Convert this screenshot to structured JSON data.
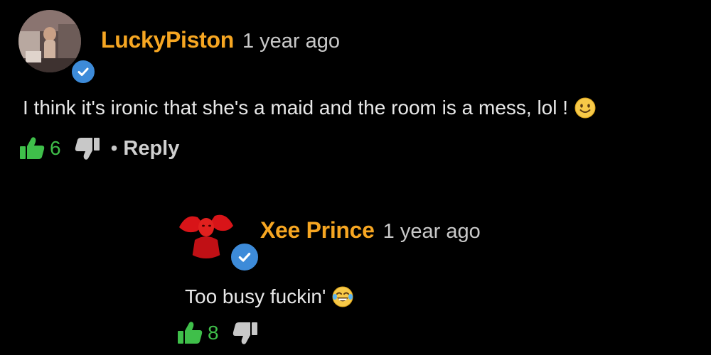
{
  "comments": [
    {
      "username": "LuckyPiston",
      "time": "1 year ago",
      "text": "I think it's ironic that she's a maid and the room is a mess, lol !",
      "emoji": "slightly-smiling-face",
      "likes": "6",
      "separator": "•",
      "reply_label": "Reply"
    },
    {
      "username": "Xee Prince",
      "time": "1 year ago",
      "text": "Too busy fuckin'",
      "emoji": "face-with-tears-of-joy",
      "likes": "8"
    }
  ],
  "colors": {
    "background": "#000000",
    "username": "#f6a622",
    "like": "#3fbf4a",
    "verified": "#3d8bd9",
    "text": "#e8e8e8",
    "muted": "#c8c8c8"
  },
  "icons": [
    "verified-badge-icon",
    "thumbs-up-icon",
    "thumbs-down-icon"
  ]
}
